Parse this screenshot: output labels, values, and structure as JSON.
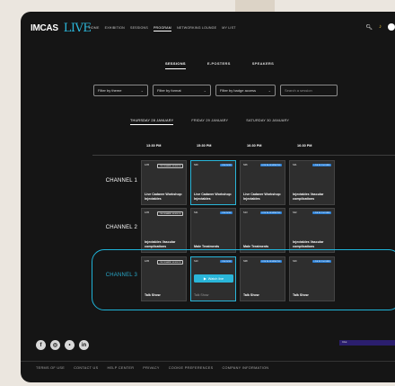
{
  "header": {
    "logo_main": "IMCAS",
    "logo_live": "LIVE",
    "nav": [
      "HOME",
      "EXHIBITION",
      "SESSIONS",
      "PROGRAM",
      "NETWORKING LOUNGE",
      "MY LIST"
    ],
    "active_nav": "PROGRAM"
  },
  "tabs": [
    "SESSIONS",
    "E-POSTERS",
    "SPEAKERS"
  ],
  "filters": {
    "theme": "Filter by theme",
    "format": "Filter by format",
    "badge": "Filter by badge access",
    "search_placeholder": "Search a session"
  },
  "days": [
    "THURSDAY 28 JANUARY",
    "FRIDAY 29 JANUARY",
    "SATURDAY 30 JANUARY"
  ],
  "times": [
    "13:30 PM",
    "15:30 PM",
    "16:30 PM",
    "16:30 PM"
  ],
  "channels": [
    {
      "label": "CHANNEL 1",
      "cards": [
        {
          "id": "1/05",
          "badge": "ON DEMAND SESSION",
          "badge_color": "gray",
          "title": "Live Cadaver Workshop: Injectables"
        },
        {
          "id": "S09",
          "badge": "LIVE NOW",
          "badge_color": "blue",
          "title": "Live Cadaver Workshop: Injectables"
        },
        {
          "id": "S06",
          "badge": "LIVE IN 45 MINUTES",
          "badge_color": "blue",
          "title": "Live Cadaver Workshop: Injectables"
        },
        {
          "id": "S41",
          "badge": "LIVE IN 2 HOURS",
          "badge_color": "blue",
          "title": "Injectables Vascular complications"
        }
      ]
    },
    {
      "label": "CHANNEL 2",
      "cards": [
        {
          "id": "1/05",
          "badge": "ON DEMAND SESSION",
          "badge_color": "gray",
          "title": "Injectables Vascular complications"
        },
        {
          "id": "S11",
          "badge": "LIVE NOW",
          "badge_color": "blue",
          "title": "Male Treatments"
        },
        {
          "id": "S13",
          "badge": "LIVE IN 45 MINUTES",
          "badge_color": "blue",
          "title": "Male Treatments"
        },
        {
          "id": "S42",
          "badge": "LIVE IN 2 HOURS",
          "badge_color": "blue",
          "title": "Injectables Vascular complications"
        }
      ]
    },
    {
      "label": "CHANNEL 3",
      "cards": [
        {
          "id": "1/05",
          "badge": "ON DEMAND SESSION",
          "badge_color": "gray",
          "title": "Talk Show"
        },
        {
          "id": "S10",
          "badge": "LIVE NOW",
          "badge_color": "blue",
          "title": "Talk Show",
          "button": "Watch live"
        },
        {
          "id": "S08",
          "badge": "LIVE IN 45 MINUTES",
          "badge_color": "blue",
          "title": "Talk Show"
        },
        {
          "id": "S40",
          "badge": "LIVE IN 2 HOURS",
          "badge_color": "blue",
          "title": "Talk Show"
        }
      ]
    }
  ],
  "chat_label": "Chat",
  "footer": [
    "TERMS OF USE",
    "CONTACT US",
    "HELP CENTER",
    "PRIVACY",
    "COOKIE PREFERENCES",
    "COMPANY INFORMATION"
  ],
  "social_icons": [
    "facebook-icon",
    "instagram-icon",
    "twitter-icon",
    "linkedin-icon"
  ],
  "colors": {
    "accent": "#2ab6d9",
    "badge_blue": "#2b7fd4",
    "background": "#151515"
  }
}
